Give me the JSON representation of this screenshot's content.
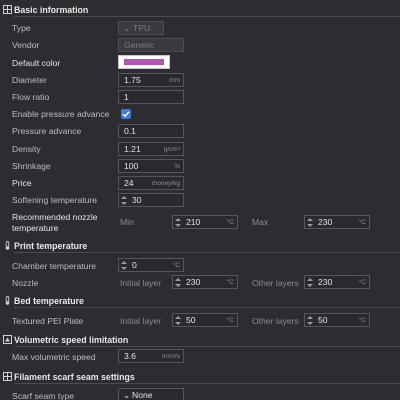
{
  "colors": {
    "background": "#2d2d31",
    "accent": "#3b7dd8",
    "default_color_swatch": "#b454b4"
  },
  "sections": {
    "basic": "Basic information",
    "print_temp": "Print temperature",
    "bed_temp": "Bed temperature",
    "volumetric": "Volumetric speed limitation",
    "scarf": "Filament scarf seam settings"
  },
  "icons": {
    "basic": "grid-icon",
    "print_temp": "thermometer-icon",
    "bed_temp": "thermometer-icon",
    "volumetric": "speed-icon",
    "scarf": "grid-icon"
  },
  "basic": {
    "type_label": "Type",
    "type_value": "TPU",
    "vendor_label": "Vendor",
    "vendor_value": "Generic",
    "default_color_label": "Default color",
    "diameter_label": "Diameter",
    "diameter_value": "1.75",
    "diameter_unit": "mm",
    "flow_ratio_label": "Flow ratio",
    "flow_ratio_value": "1",
    "enable_pa_label": "Enable pressure advance",
    "enable_pa_checked": true,
    "pa_label": "Pressure advance",
    "pa_value": "0.1",
    "density_label": "Density",
    "density_value": "1.21",
    "density_unit": "g/cm³",
    "shrinkage_label": "Shrinkage",
    "shrinkage_value": "100",
    "shrinkage_unit": "%",
    "price_label": "Price",
    "price_value": "24",
    "price_unit": "money/kg",
    "softening_label": "Softening temperature",
    "softening_value": "30",
    "softening_unit": "°C",
    "nozzle_temp_label_1": "Recommended nozzle",
    "nozzle_temp_label_2": "temperature",
    "min_label": "Min",
    "min_value": "210",
    "min_unit": "°C",
    "max_label": "Max",
    "max_value": "230",
    "max_unit": "°C"
  },
  "print_temp": {
    "chamber_label": "Chamber temperature",
    "chamber_value": "0",
    "chamber_unit": "°C",
    "nozzle_label": "Nozzle",
    "initial_layer_label": "Initial layer",
    "initial_value": "230",
    "initial_unit": "°C",
    "other_layers_label": "Other layers",
    "other_value": "230",
    "other_unit": "°C"
  },
  "bed_temp": {
    "plate_label": "Textured PEI Plate",
    "initial_layer_label": "Initial layer",
    "initial_value": "50",
    "initial_unit": "°C",
    "other_layers_label": "Other layers",
    "other_value": "50",
    "other_unit": "°C"
  },
  "volumetric": {
    "max_speed_label": "Max volumetric speed",
    "max_speed_value": "3.6",
    "max_speed_unit": "mm³/s"
  },
  "scarf": {
    "seam_type_label": "Scarf seam type",
    "seam_type_value": "None"
  }
}
